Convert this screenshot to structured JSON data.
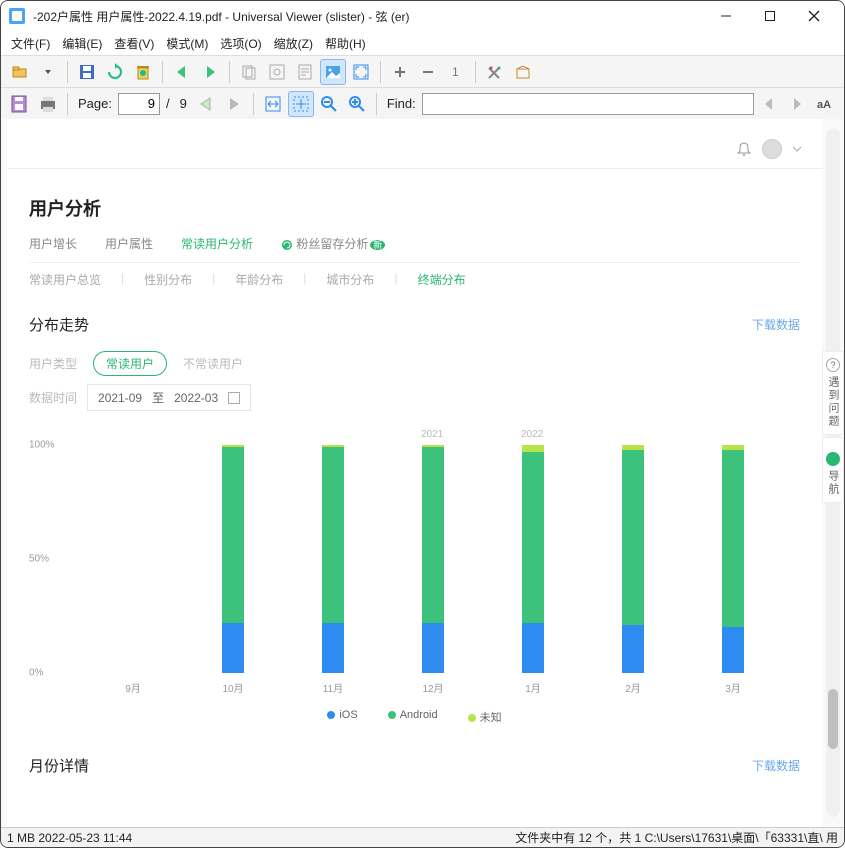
{
  "window": {
    "title": "-202户属性 用户属性-2022.4.19.pdf - Universal Viewer (slister) - 弦 (er)"
  },
  "menu": {
    "file": "文件(F)",
    "edit": "编辑(E)",
    "view": "查看(V)",
    "mode": "模式(M)",
    "options": "选项(O)",
    "zoom": "缩放(Z)",
    "help": "帮助(H)"
  },
  "toolbar2": {
    "page_label": "Page:",
    "page_current": "9",
    "page_sep": "/",
    "page_total": "9",
    "find_label": "Find:",
    "find_value": ""
  },
  "doc": {
    "heading": "用户分析",
    "tabs": {
      "t1": "用户增长",
      "t2": "用户属性",
      "t3": "常读用户分析",
      "t4": "粉丝留存分析",
      "badge": "新"
    },
    "subtabs": {
      "s1": "常读用户总览",
      "s2": "性别分布",
      "s3": "年龄分布",
      "s4": "城市分布",
      "s5": "终端分布"
    },
    "panel1": {
      "title": "分布走势",
      "download": "下载数据",
      "user_type_label": "用户类型",
      "pill_active": "常读用户",
      "pill_inactive": "不常读用户",
      "date_label": "数据时间",
      "date_from": "2021-09",
      "date_to": "2022-03",
      "date_sep": "至"
    },
    "legend": {
      "l1": "iOS",
      "l2": "Android",
      "l3": "未知"
    },
    "panel2": {
      "title": "月份详情",
      "download": "下载数据"
    }
  },
  "sidebar_widgets": {
    "help_icon": "?",
    "help_text": "遇到问题",
    "nav_text": "导航"
  },
  "statusbar": {
    "left": "1 MB  2022-05-23 11:44",
    "right": "文件夹中有 12 个，共 1 C:\\Users\\17631\\桌面\\「63331\\直\\ 用"
  },
  "chart_data": {
    "type": "bar",
    "stacked": true,
    "ylabel_pct": true,
    "ylim": [
      0,
      100
    ],
    "yticks": [
      0,
      50,
      100
    ],
    "categories": [
      "9月",
      "10月",
      "11月",
      "12月",
      "1月",
      "2月",
      "3月"
    ],
    "time_badges": [
      {
        "at_index": 3,
        "label": "2021"
      },
      {
        "at_index": 4,
        "label": "2022"
      }
    ],
    "series": [
      {
        "name": "iOS",
        "color": "#2e8bf0",
        "values": [
          0,
          22,
          22,
          22,
          22,
          21,
          20
        ]
      },
      {
        "name": "Android",
        "color": "#3cc27a",
        "values": [
          0,
          77,
          77,
          77,
          75,
          77,
          78
        ]
      },
      {
        "name": "未知",
        "color": "#b6e24a",
        "values": [
          0,
          1,
          1,
          1,
          3,
          2,
          2
        ]
      }
    ]
  }
}
